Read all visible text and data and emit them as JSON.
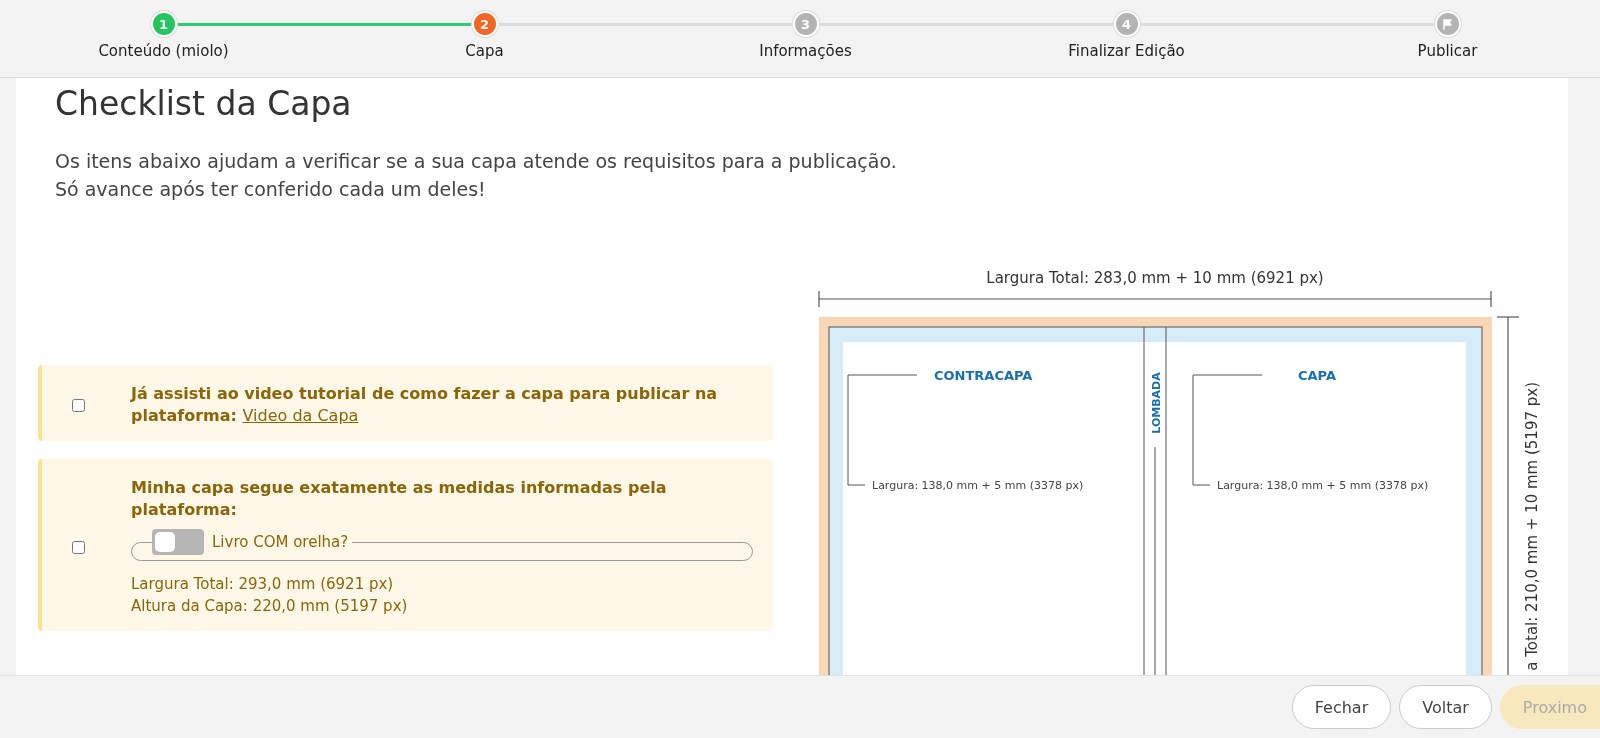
{
  "steps": [
    {
      "number": "1",
      "label": "Conteúdo (miolo)",
      "done": true,
      "selected": false
    },
    {
      "number": "2",
      "label": "Capa",
      "done": false,
      "selected": true
    },
    {
      "number": "3",
      "label": "Informações",
      "done": false,
      "selected": false
    },
    {
      "number": "4",
      "label": "Finalizar Edição",
      "done": false,
      "selected": false
    },
    {
      "kind": "flag",
      "label": "Publicar",
      "done": false,
      "selected": false
    }
  ],
  "heading": "Checklist da Capa",
  "intro": [
    "Os itens abaixo ajudam a verificar se a sua capa atende os requisitos para a publicação.",
    "Só avance após ter conferido cada um deles!"
  ],
  "checklist": [
    {
      "kind": "link",
      "text": "Já assisti ao video tutorial de como fazer a capa para publicar na plataforma:",
      "link": "Video da Capa",
      "checked": false
    },
    {
      "kind": "measures",
      "text": "Minha capa segue exatamente as medidas informadas pela plataforma:",
      "toggle": {
        "label": "Livro COM orelha?",
        "on": false
      },
      "details": [
        "Largura Total: 293,0 mm (6921 px)",
        "Altura da Capa: 220,0 mm (5197 px)"
      ],
      "checked": false
    }
  ],
  "diagram": {
    "total_width": "Largura Total: 283,0 mm + 10 mm (6921 px)",
    "back_cover": "CONTRACAPA",
    "spine": "LOMBADA",
    "front_cover": "CAPA",
    "back_width": "Largura: 138,0 mm + 5 mm (3378 px)",
    "front_width": "Largura: 138,0 mm + 5 mm (3378 px)",
    "total_height": "a Total: 210,0 mm + 10 mm (5197 px)"
  },
  "buttons": [
    {
      "label": "Fechar",
      "disabled": false
    },
    {
      "label": "Voltar",
      "disabled": false
    },
    {
      "label": "Proximo",
      "disabled": true
    }
  ]
}
